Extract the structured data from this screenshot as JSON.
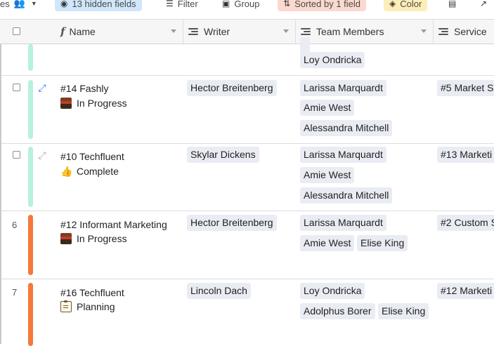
{
  "toolbar": {
    "partial_label": "es",
    "hidden_fields": "13 hidden fields",
    "filter": "Filter",
    "group": "Group",
    "sorted": "Sorted by 1 field",
    "color": "Color"
  },
  "columns": {
    "name": "Name",
    "writer": "Writer",
    "team_members": "Team Members",
    "service": "Service"
  },
  "top_row": {
    "team_members": [
      "Loy Ondricka"
    ]
  },
  "rows": [
    {
      "number": "",
      "title": "#14 Fashly",
      "status": "In Progress",
      "writer": "Hector Breitenberg",
      "team": [
        [
          "Larissa Marquardt"
        ],
        [
          "Amie West"
        ],
        [
          "Alessandra Mitchell"
        ]
      ],
      "service": "#5 Market S"
    },
    {
      "number": "",
      "title": "#10 Techfluent",
      "status": "Complete",
      "writer": "Skylar Dickens",
      "team": [
        [
          "Larissa Marquardt"
        ],
        [
          "Amie West"
        ],
        [
          "Alessandra Mitchell"
        ]
      ],
      "service": "#13 Marketi"
    },
    {
      "number": "6",
      "title": "#12 Informant Marketing",
      "status": "In Progress",
      "writer": "Hector Breitenberg",
      "team": [
        [
          "Larissa Marquardt"
        ],
        [
          "Amie West",
          "Elise King"
        ]
      ],
      "service": "#2 Custom S"
    },
    {
      "number": "7",
      "title": "#16 Techfluent",
      "status": "Planning",
      "writer": "Lincoln Dach",
      "team": [
        [
          "Loy Ondricka"
        ],
        [
          "Adolphus Borer",
          "Elise King"
        ]
      ],
      "service": "#12 Marketi"
    }
  ],
  "colors": {
    "bar_mint": "#b8f0e0",
    "bar_orange": "#f5793a",
    "chip_bg": "#e9ecf3",
    "header_bg": "#f6f6f6",
    "hidden_fields_bg": "#cfe6fb",
    "sorted_bg": "#fbd9cf",
    "color_bg": "#fdeeb8"
  },
  "icons": {
    "expand_active": "expand-arrows-icon",
    "expand_inactive": "expand-arrows-icon",
    "in_progress": "construction-icon",
    "complete": "thumbs-up-icon",
    "planning": "clipboard-icon"
  }
}
